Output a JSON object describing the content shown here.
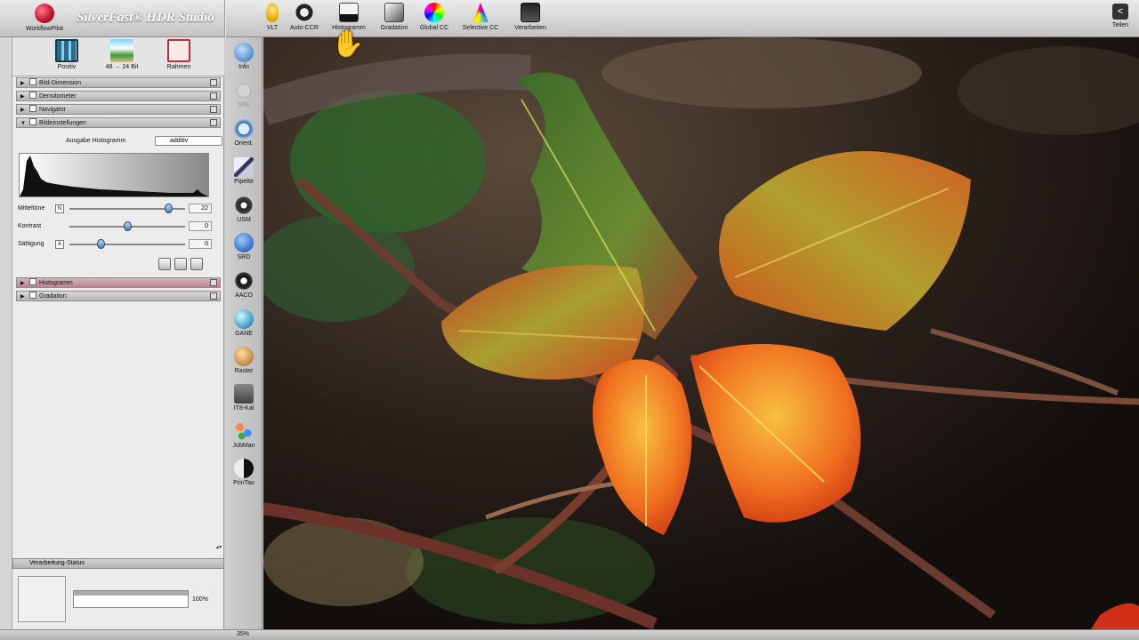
{
  "app": {
    "brand": "SilverFast® HDR Studio",
    "workflow_label": "WorkflowPilot"
  },
  "toolbar": {
    "items": [
      {
        "label": "VLT",
        "icon": "vlt-bulb-icon"
      },
      {
        "label": "Auto-CCR",
        "icon": "auto-adjust-icon"
      },
      {
        "label": "Histogramm",
        "icon": "histogram-icon"
      },
      {
        "label": "Gradation",
        "icon": "gradation-icon"
      },
      {
        "label": "Global CC",
        "icon": "global-cc-icon"
      },
      {
        "label": "Selective CC",
        "icon": "selective-cc-icon"
      },
      {
        "label": "Verarbeiten",
        "icon": "process-icon"
      }
    ],
    "share_label": "Teilen"
  },
  "modes": [
    {
      "label": "Positiv",
      "icon": "film-strip-icon"
    },
    {
      "label": "48 → 24 Bit",
      "icon": "bit-depth-icon"
    },
    {
      "label": "Rahmen",
      "icon": "frame-icon"
    }
  ],
  "sections": {
    "bild_dimension": "Bild-Dimension",
    "densitometer": "Densitometer",
    "navigator": "Navigator",
    "bildeinstellungen": "Bildeinstellungen",
    "histogramm": "Histogramm",
    "gradation": "Gradation"
  },
  "bildeinstellungen": {
    "ausgabe_label": "Ausgabe Histogramm",
    "ausgabe_value": "additiv",
    "sliders": [
      {
        "name": "Mitteltöne",
        "value": "22",
        "level": 0.85
      },
      {
        "name": "Kontrast",
        "value": "0",
        "level": 0.5
      },
      {
        "name": "Sättigung",
        "value": "0",
        "level": 0.27
      }
    ]
  },
  "status": {
    "title": "Verarbeitung-Status",
    "percent": "100%",
    "progress": 1.0
  },
  "vertical_tools": [
    {
      "label": "Info",
      "icon": "info-icon"
    },
    {
      "label": "50%",
      "icon": "zoom-icon"
    },
    {
      "label": "Orient.",
      "icon": "orientation-icon"
    },
    {
      "label": "Pipette",
      "icon": "pipette-icon"
    },
    {
      "label": "USM",
      "icon": "usm-icon"
    },
    {
      "label": "SRD",
      "icon": "srd-icon"
    },
    {
      "label": "AACO",
      "icon": "aaco-icon"
    },
    {
      "label": "GANE",
      "icon": "gane-icon"
    },
    {
      "label": "Raster",
      "icon": "raster-icon"
    },
    {
      "label": "IT8-Kal",
      "icon": "it8-icon"
    },
    {
      "label": "JobMan",
      "icon": "jobman-icon"
    },
    {
      "label": "PrinTao",
      "icon": "printao-icon"
    }
  ],
  "bottom": {
    "zoom": "35%"
  }
}
